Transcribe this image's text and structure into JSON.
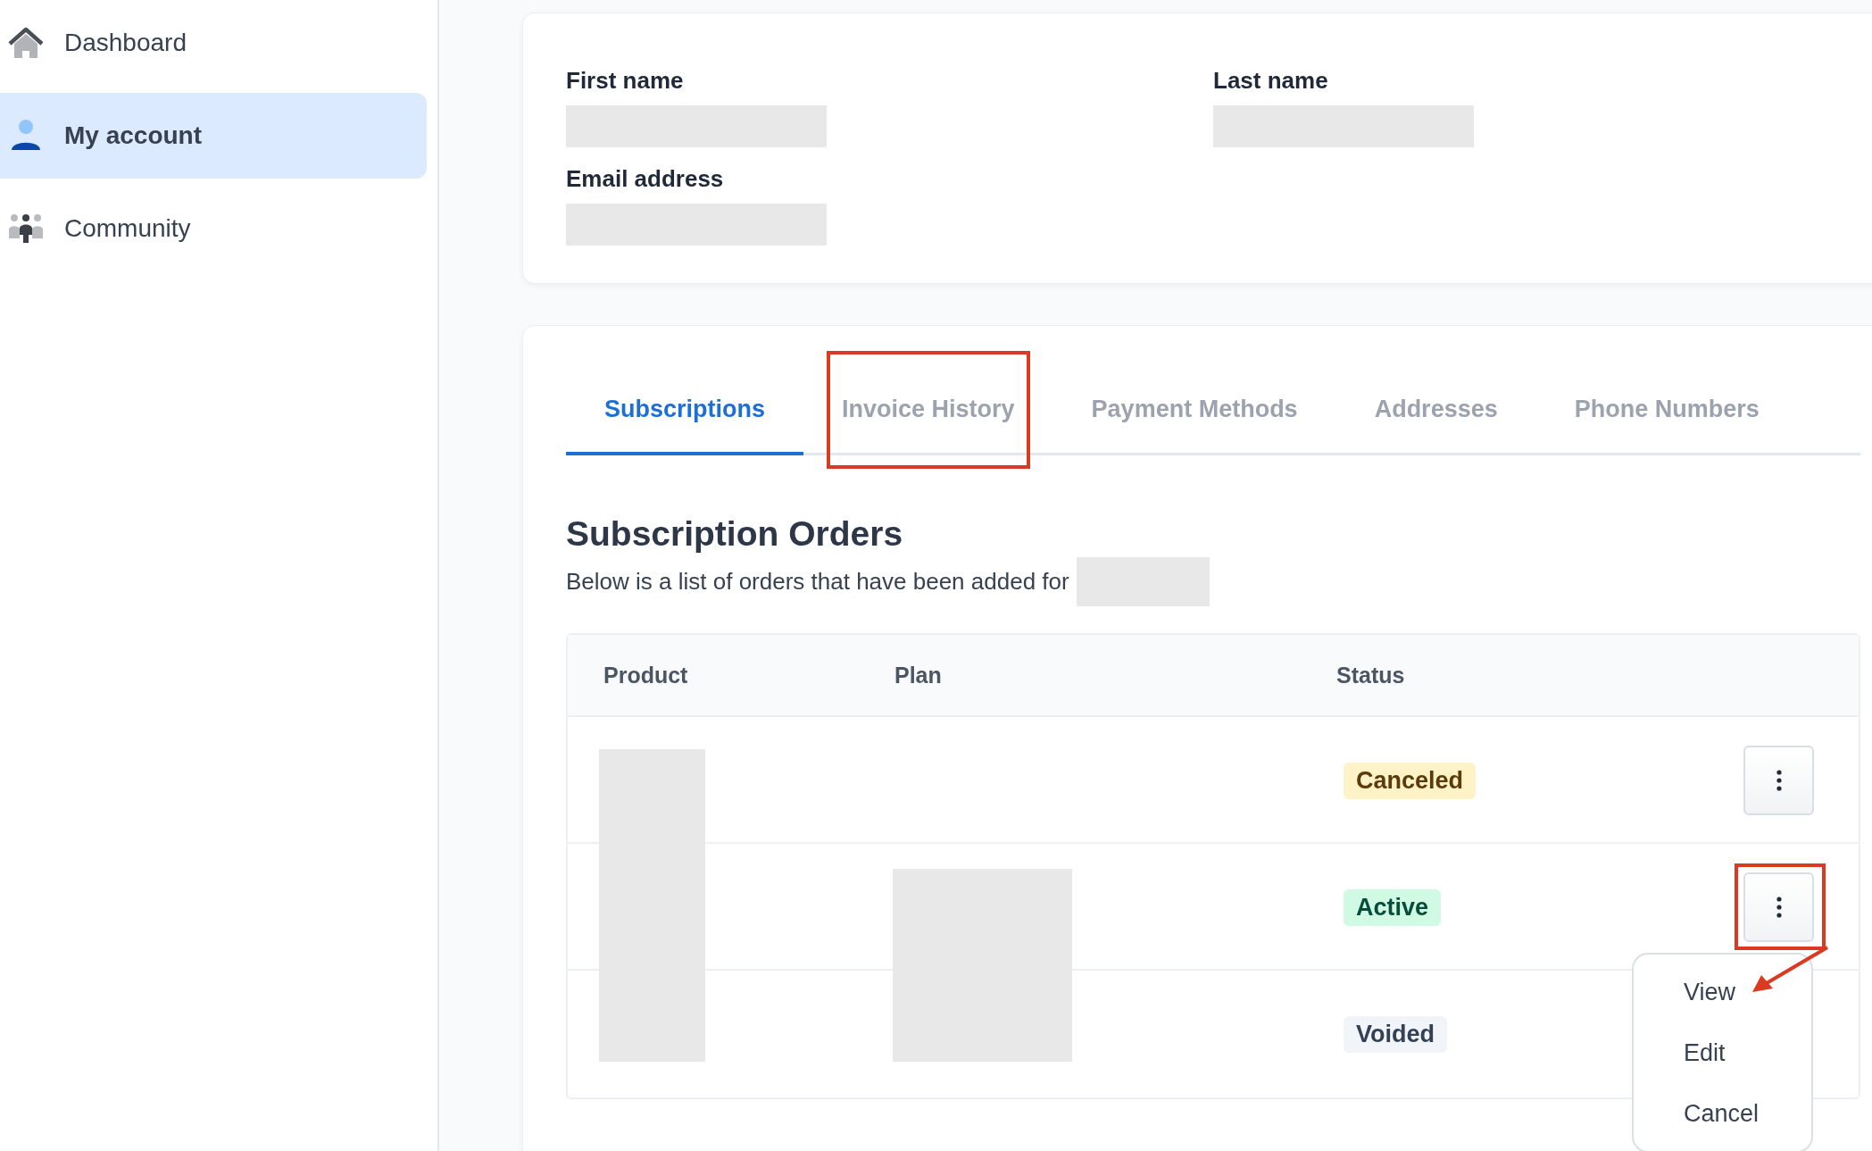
{
  "sidebar": {
    "items": [
      {
        "label": "Dashboard",
        "selected": false
      },
      {
        "label": "My account",
        "selected": true
      },
      {
        "label": "Community",
        "selected": false
      }
    ]
  },
  "profile": {
    "fields": [
      {
        "label": "First name"
      },
      {
        "label": "Last name"
      },
      {
        "label": "Email address"
      }
    ]
  },
  "tabs": [
    {
      "label": "Subscriptions",
      "selected": true,
      "highlighted": false
    },
    {
      "label": "Invoice History",
      "selected": false,
      "highlighted": true
    },
    {
      "label": "Payment Methods",
      "selected": false,
      "highlighted": false
    },
    {
      "label": "Addresses",
      "selected": false,
      "highlighted": false
    },
    {
      "label": "Phone Numbers",
      "selected": false,
      "highlighted": false
    }
  ],
  "section": {
    "title": "Subscription Orders",
    "subtitle": "Below is a list of orders that have been added for"
  },
  "table": {
    "columns": [
      "Product",
      "Plan",
      "Status"
    ],
    "rows": [
      {
        "status": "Canceled",
        "color": "#fef3c7",
        "highlighted": false,
        "menu_open": false
      },
      {
        "status": "Active",
        "color": "#d1fae5",
        "highlighted": true,
        "menu_open": true
      },
      {
        "status": "Voided",
        "color": "#f1f4f8",
        "highlighted": false,
        "menu_open": false
      }
    ]
  },
  "menu": {
    "items": [
      "View",
      "Edit",
      "Cancel"
    ]
  }
}
